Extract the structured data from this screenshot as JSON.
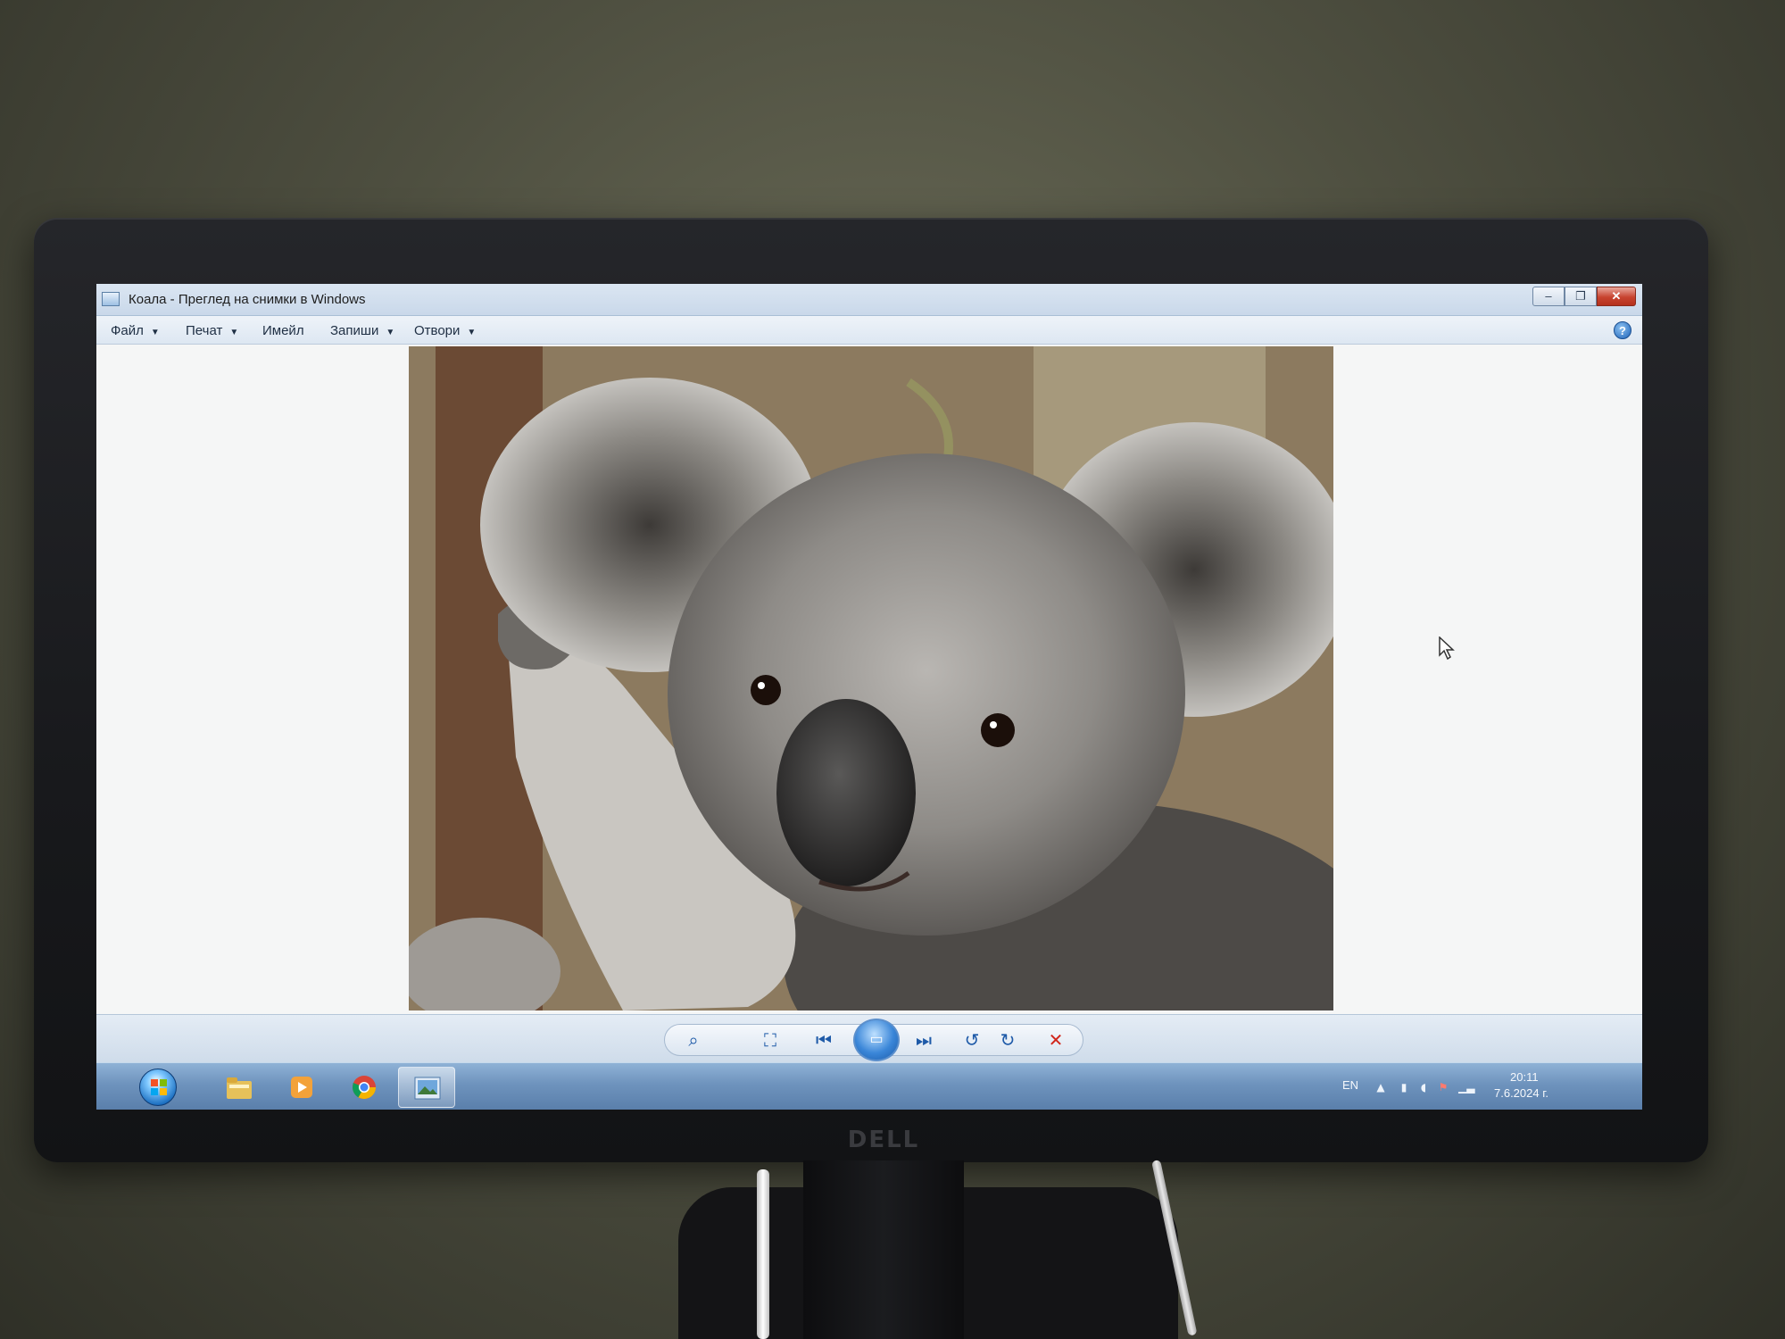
{
  "window": {
    "title": "Коала - Преглед на снимки в Windows",
    "controls": {
      "minimize": "–",
      "maximize": "❐",
      "close": "✕"
    }
  },
  "menu": {
    "items": [
      {
        "label": "Файл",
        "has_dropdown": true
      },
      {
        "label": "Печат",
        "has_dropdown": true
      },
      {
        "label": "Имейл",
        "has_dropdown": false
      },
      {
        "label": "Запиши",
        "has_dropdown": true
      },
      {
        "label": "Отвори",
        "has_dropdown": true
      }
    ],
    "help": "?"
  },
  "viewer": {
    "image_subject": "koala",
    "controls": [
      {
        "name": "zoom",
        "icon": "magnifier-icon"
      },
      {
        "name": "actual-size",
        "icon": "fit-icon"
      },
      {
        "name": "previous",
        "icon": "prev-icon"
      },
      {
        "name": "slideshow",
        "icon": "slideshow-icon"
      },
      {
        "name": "next",
        "icon": "next-icon"
      },
      {
        "name": "rotate-left",
        "icon": "rotate-ccw-icon"
      },
      {
        "name": "rotate-right",
        "icon": "rotate-cw-icon"
      },
      {
        "name": "delete",
        "icon": "delete-icon"
      }
    ]
  },
  "taskbar": {
    "pinned": [
      "explorer-icon",
      "media-player-icon",
      "chrome-icon",
      "photo-viewer-icon"
    ],
    "active": "photo-viewer-icon",
    "tray": {
      "language": "EN",
      "time": "20:11",
      "date": "7.6.2024 г."
    }
  },
  "monitor": {
    "brand": "DELL"
  },
  "colors": {
    "titlebar": "#c9d8ea",
    "taskbar": "#6e93bd",
    "close_button": "#c7432f",
    "accent": "#1e5aa8"
  }
}
